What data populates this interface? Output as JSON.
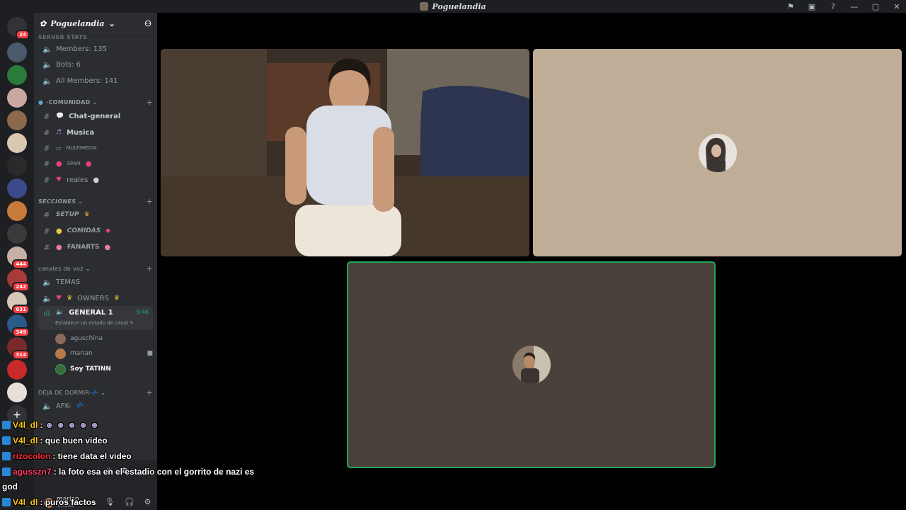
{
  "window": {
    "title": "Poguelandia"
  },
  "guilds": {
    "dm_badge": "24",
    "badges": [
      "444",
      "242",
      "631",
      "349",
      "314"
    ]
  },
  "server": {
    "name": "Poguelandia"
  },
  "stats": {
    "header": "SERVER STATS",
    "members": "Members: 135",
    "bots": "Bots: 6",
    "all_members": "All Members: 141"
  },
  "categories": {
    "comunidad": "COMUNIDAD",
    "secciones": "SECCIONES",
    "voz": "canales de voz",
    "dormir": "DEJA DE DORMIR-"
  },
  "channels": {
    "chat_general": "Chat-general",
    "musica": "Musica",
    "multimedia": "MULTIMEDIA",
    "spam": "SPAM",
    "reales": "reales",
    "setup": "SETUP",
    "comidas": "COMIDAS",
    "fanarts": "FANARTS",
    "temas": "TEMAS",
    "owners": "OWNERS",
    "general1": "GENERAL 1",
    "general1_time": "9:46",
    "general1_status": "Establece un estado de canal",
    "afk": "AFK-"
  },
  "voice_members": [
    "aguschina",
    "marian",
    "Soy TATINN"
  ],
  "user_panel": {
    "name": "marian",
    "status": "Invisible"
  },
  "chat": [
    {
      "user": "V4l_dl",
      "text": ":"
    },
    {
      "user": "V4l_dl",
      "text": ": que buen video"
    },
    {
      "user": "rizocolon",
      "text": ": tiene data el video"
    },
    {
      "user": "agusszn7",
      "text": ": la foto esa en el estadio con el gorrito de nazi es"
    },
    {
      "user": "",
      "text": "god"
    },
    {
      "user": "V4l_dl",
      "text": ": puros factos"
    }
  ],
  "colors": {
    "speaking_border": "#23a55a",
    "mention_badge": "#f23f43",
    "accent_time": "#23a55a"
  },
  "icons": [
    "flag-icon",
    "screen-icon",
    "help-icon",
    "minimize-icon",
    "maximize-icon",
    "close-icon",
    "speaker-icon",
    "hash-icon",
    "camera-icon",
    "mic-icon",
    "headphones-icon",
    "gear-icon",
    "plus-icon"
  ]
}
